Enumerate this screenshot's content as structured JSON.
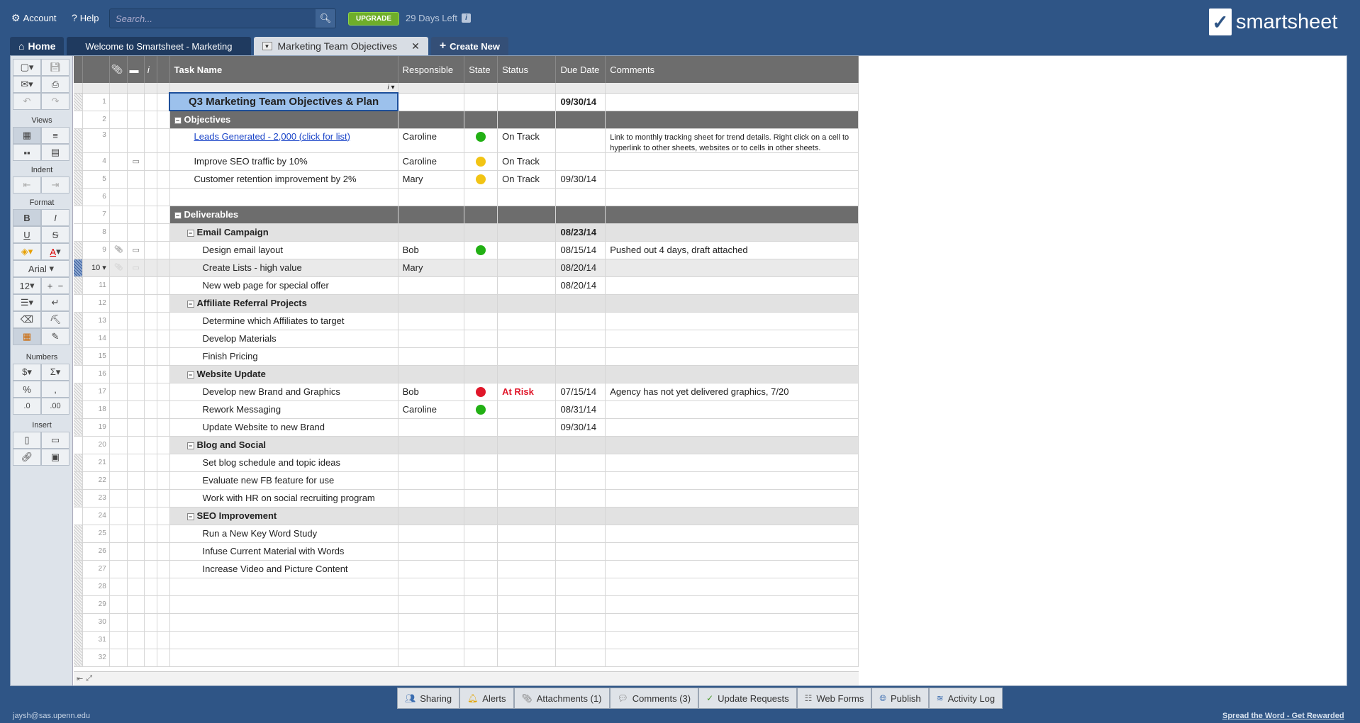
{
  "topbar": {
    "account": "Account",
    "help": "Help",
    "search_placeholder": "Search...",
    "upgrade": "UPGRADE",
    "days_left": "29 Days Left",
    "logo": "smartsheet"
  },
  "tabs": {
    "home": "Home",
    "t1": "Welcome to Smartsheet - Marketing",
    "t2": "Marketing Team Objectives",
    "create": "Create New"
  },
  "toolbar": {
    "views": "Views",
    "indent": "Indent",
    "format": "Format",
    "font": "Arial",
    "size": "12",
    "numbers": "Numbers",
    "insert": "Insert"
  },
  "columns": [
    "Task Name",
    "Responsible",
    "State",
    "Status",
    "Due Date",
    "Comments"
  ],
  "rows": [
    {
      "n": "1",
      "task": "Q3 Marketing Team Objectives & Plan",
      "resp": "",
      "state": "",
      "status": "",
      "due": "09/30/14",
      "comment": ""
    },
    {
      "n": "2",
      "task": "Objectives",
      "resp": "",
      "state": "",
      "status": "",
      "due": "",
      "comment": ""
    },
    {
      "n": "3",
      "task": "Leads Generated - 2,000 (click for list)",
      "resp": "Caroline",
      "state": "green",
      "status": "On Track",
      "due": "",
      "comment": "Link to monthly tracking sheet for trend details. Right click on a cell to hyperlink to other sheets, websites or to cells in other sheets."
    },
    {
      "n": "4",
      "task": "Improve SEO traffic by 10%",
      "resp": "Caroline",
      "state": "yellow",
      "status": "On Track",
      "due": "",
      "comment": ""
    },
    {
      "n": "5",
      "task": "Customer retention improvement by 2%",
      "resp": "Mary",
      "state": "yellow",
      "status": "On Track",
      "due": "09/30/14",
      "comment": ""
    },
    {
      "n": "6",
      "task": "",
      "resp": "",
      "state": "",
      "status": "",
      "due": "",
      "comment": ""
    },
    {
      "n": "7",
      "task": "Deliverables",
      "resp": "",
      "state": "",
      "status": "",
      "due": "",
      "comment": ""
    },
    {
      "n": "8",
      "task": "Email Campaign",
      "resp": "",
      "state": "",
      "status": "",
      "due": "08/23/14",
      "comment": ""
    },
    {
      "n": "9",
      "task": "Design email layout",
      "resp": "Bob",
      "state": "green",
      "status": "",
      "due": "08/15/14",
      "comment": "Pushed out 4 days, draft attached"
    },
    {
      "n": "10",
      "task": "Create Lists - high value",
      "resp": "Mary",
      "state": "",
      "status": "",
      "due": "08/20/14",
      "comment": ""
    },
    {
      "n": "11",
      "task": "New web page for special offer",
      "resp": "",
      "state": "",
      "status": "",
      "due": "08/20/14",
      "comment": ""
    },
    {
      "n": "12",
      "task": "Affiliate Referral Projects",
      "resp": "",
      "state": "",
      "status": "",
      "due": "",
      "comment": ""
    },
    {
      "n": "13",
      "task": "Determine which Affiliates to target",
      "resp": "",
      "state": "",
      "status": "",
      "due": "",
      "comment": ""
    },
    {
      "n": "14",
      "task": "Develop Materials",
      "resp": "",
      "state": "",
      "status": "",
      "due": "",
      "comment": ""
    },
    {
      "n": "15",
      "task": "Finish Pricing",
      "resp": "",
      "state": "",
      "status": "",
      "due": "",
      "comment": ""
    },
    {
      "n": "16",
      "task": "Website Update",
      "resp": "",
      "state": "",
      "status": "",
      "due": "",
      "comment": ""
    },
    {
      "n": "17",
      "task": "Develop new Brand and Graphics",
      "resp": "Bob",
      "state": "red",
      "status": "At Risk",
      "due": "07/15/14",
      "comment": "Agency has not yet delivered graphics, 7/20"
    },
    {
      "n": "18",
      "task": "Rework Messaging",
      "resp": "Caroline",
      "state": "green",
      "status": "",
      "due": "08/31/14",
      "comment": ""
    },
    {
      "n": "19",
      "task": "Update Website to new Brand",
      "resp": "",
      "state": "",
      "status": "",
      "due": "09/30/14",
      "comment": ""
    },
    {
      "n": "20",
      "task": "Blog and Social",
      "resp": "",
      "state": "",
      "status": "",
      "due": "",
      "comment": ""
    },
    {
      "n": "21",
      "task": "Set blog schedule and topic ideas",
      "resp": "",
      "state": "",
      "status": "",
      "due": "",
      "comment": ""
    },
    {
      "n": "22",
      "task": "Evaluate new FB feature for use",
      "resp": "",
      "state": "",
      "status": "",
      "due": "",
      "comment": ""
    },
    {
      "n": "23",
      "task": "Work with HR on social recruiting program",
      "resp": "",
      "state": "",
      "status": "",
      "due": "",
      "comment": ""
    },
    {
      "n": "24",
      "task": "SEO Improvement",
      "resp": "",
      "state": "",
      "status": "",
      "due": "",
      "comment": ""
    },
    {
      "n": "25",
      "task": "Run a New Key Word Study",
      "resp": "",
      "state": "",
      "status": "",
      "due": "",
      "comment": ""
    },
    {
      "n": "26",
      "task": "Infuse Current Material with Words",
      "resp": "",
      "state": "",
      "status": "",
      "due": "",
      "comment": ""
    },
    {
      "n": "27",
      "task": "Increase Video and Picture Content",
      "resp": "",
      "state": "",
      "status": "",
      "due": "",
      "comment": ""
    },
    {
      "n": "28",
      "task": "",
      "resp": "",
      "state": "",
      "status": "",
      "due": "",
      "comment": ""
    },
    {
      "n": "29",
      "task": "",
      "resp": "",
      "state": "",
      "status": "",
      "due": "",
      "comment": ""
    },
    {
      "n": "30",
      "task": "",
      "resp": "",
      "state": "",
      "status": "",
      "due": "",
      "comment": ""
    },
    {
      "n": "31",
      "task": "",
      "resp": "",
      "state": "",
      "status": "",
      "due": "",
      "comment": ""
    },
    {
      "n": "32",
      "task": "",
      "resp": "",
      "state": "",
      "status": "",
      "due": "",
      "comment": ""
    }
  ],
  "bottom_tabs": [
    "Sharing",
    "Alerts",
    "Attachments (1)",
    "Comments (3)",
    "Update Requests",
    "Web Forms",
    "Publish",
    "Activity Log"
  ],
  "footer": {
    "user": "jaysh@sas.upenn.edu",
    "spread": "Spread the Word - Get Rewarded"
  }
}
